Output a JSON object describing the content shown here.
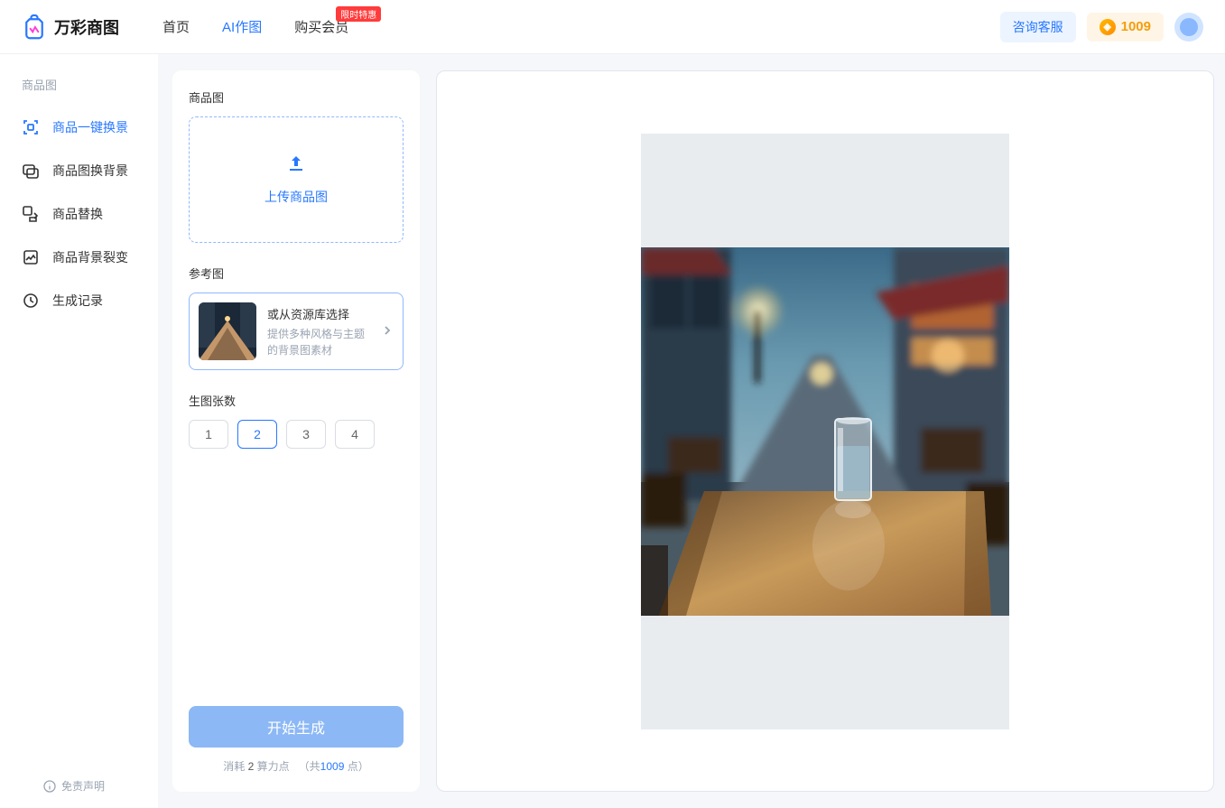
{
  "header": {
    "brand": "万彩商图",
    "nav": {
      "home": "首页",
      "ai": "AI作图",
      "buy": "购买会员",
      "badge": "限时特惠"
    },
    "cs_label": "咨询客服",
    "coin_count": "1009"
  },
  "sidebar": {
    "group_title": "商品图",
    "items": [
      {
        "label": "商品一键换景"
      },
      {
        "label": "商品图换背景"
      },
      {
        "label": "商品替换"
      },
      {
        "label": "商品背景裂变"
      },
      {
        "label": "生成记录"
      }
    ],
    "disclaimer": "免责声明"
  },
  "panel": {
    "upload_label": "商品图",
    "upload_text": "上传商品图",
    "ref_label": "参考图",
    "ref_title": "或从资源库选择",
    "ref_desc": "提供多种风格与主题的背景图素材",
    "count_section_label": "生图张数",
    "counts": [
      "1",
      "2",
      "3",
      "4"
    ],
    "count_selected": "2",
    "generate_label": "开始生成",
    "cost_prefix": "消耗 ",
    "cost_value": "2",
    "cost_unit": " 算力点",
    "total_prefix": "（共",
    "total_value": "1009",
    "total_suffix": " 点）"
  }
}
